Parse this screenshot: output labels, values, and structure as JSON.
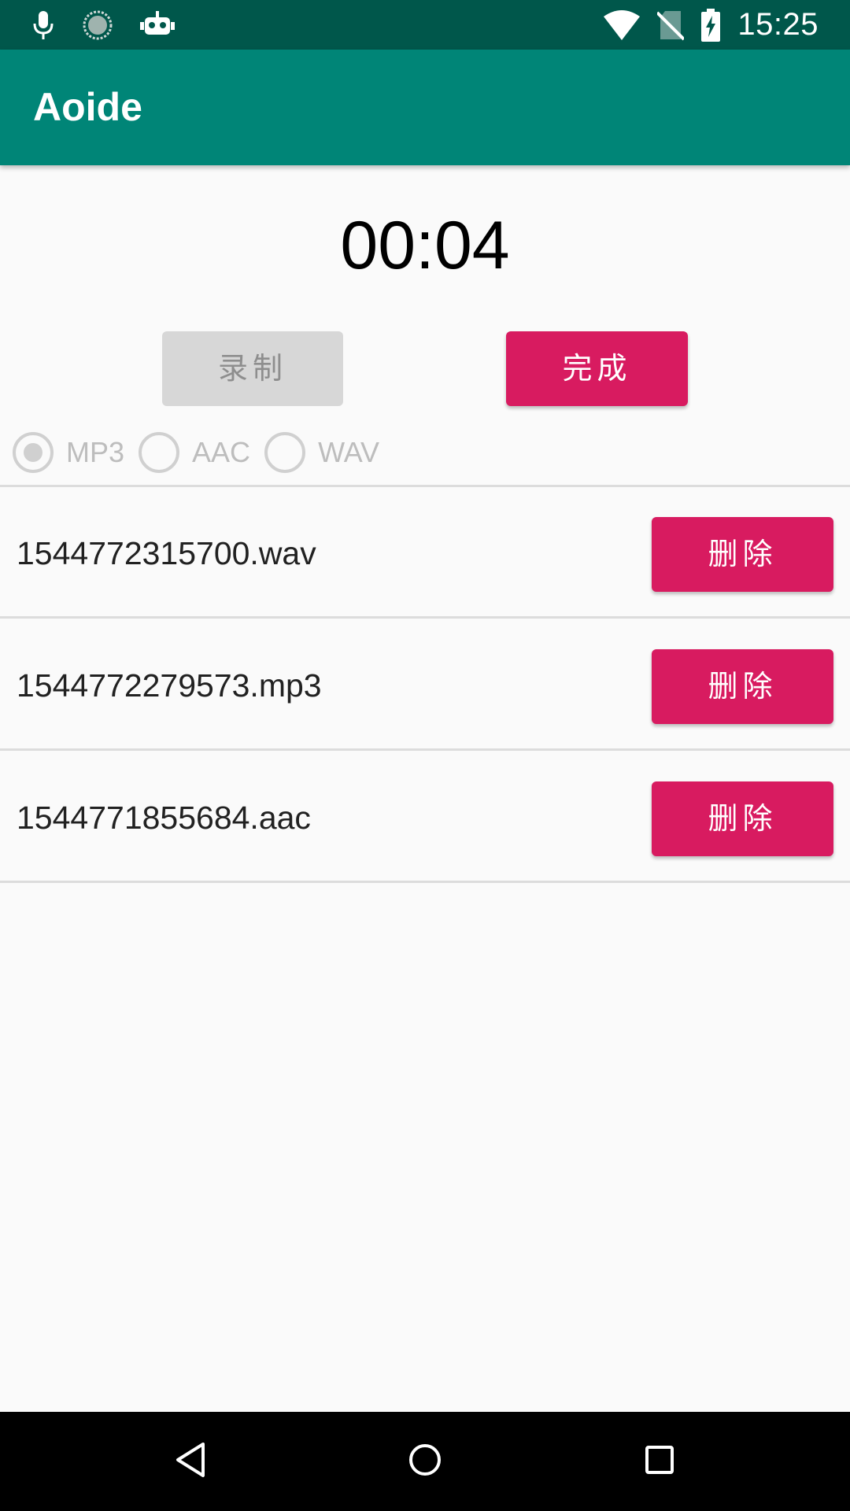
{
  "status_bar": {
    "time": "15:25",
    "left_icons": [
      "mic-icon",
      "loading-icon",
      "android-debug-icon"
    ],
    "right_icons": [
      "wifi-icon",
      "no-sim-icon",
      "battery-charging-icon"
    ]
  },
  "app_bar": {
    "title": "Aoide"
  },
  "timer": {
    "value": "00:04"
  },
  "controls": {
    "record_label": "录制",
    "done_label": "完成"
  },
  "formats": {
    "selected": "MP3",
    "options": [
      "MP3",
      "AAC",
      "WAV"
    ]
  },
  "recordings": [
    {
      "file_name": "1544772315700.wav",
      "delete_label": "删除"
    },
    {
      "file_name": "1544772279573.mp3",
      "delete_label": "删除"
    },
    {
      "file_name": "1544771855684.aac",
      "delete_label": "删除"
    }
  ],
  "colors": {
    "status_bar": "#00574b",
    "app_bar": "#008577",
    "accent": "#d81b60",
    "disabled_button": "#d7d7d7"
  }
}
